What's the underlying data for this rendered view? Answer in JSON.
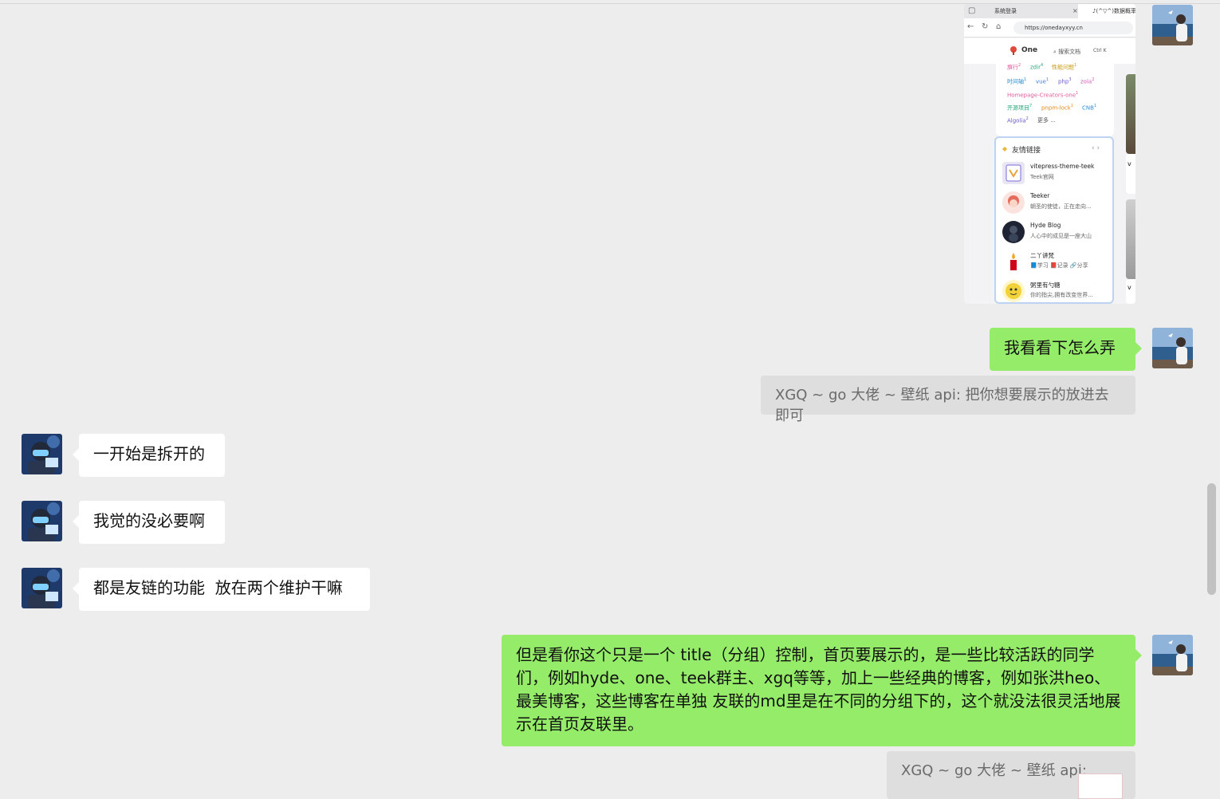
{
  "messages": {
    "m1": "我看看下怎么弄",
    "q1": "XGQ ~ go 大佬 ~ 壁纸 api: 把你想要展示的放进去即可",
    "m2": "一开始是拆开的",
    "m3": "我觉的没必要啊",
    "m4": "都是友链的功能  放在两个维护干嘛",
    "m5": "但是看你这个只是一个 title（分组）控制，首页要展示的，是一些比较活跃的同学们，例如hyde、one、teek群主、xgq等等，加上一些经典的博客，例如张洪heo、最美博客，这些博客在单独 友联的md里是在不同的分组下的，这个就没法很灵活地展示在首页友联里。",
    "q2": "XGQ ~ go 大佬 ~ 壁纸 api:"
  },
  "screenshot": {
    "tab1": "系统登录",
    "tab1_close": "×",
    "tab2": "♪(^▽^)数据概率",
    "url": "https://onedayxyy.cn",
    "logo": "One",
    "search": "搜索文档",
    "search_key": "Ctrl K",
    "tags": [
      {
        "label": "旗行",
        "count": "2",
        "color": "#e0559b"
      },
      {
        "label": "zdir",
        "count": "4",
        "color": "#23a67a"
      },
      {
        "label": "性能问题",
        "count": "1",
        "color": "#c99b12"
      },
      {
        "label": "时间轴",
        "count": "1",
        "color": "#2b8fd6"
      },
      {
        "label": "vue",
        "count": "1",
        "color": "#3b7ee0"
      },
      {
        "label": "php",
        "count": "3",
        "color": "#6a5acd"
      },
      {
        "label": "zola",
        "count": "2",
        "color": "#d35bb5"
      },
      {
        "label": "Homepage-Creators-one",
        "count": "1",
        "color": "#e05b9b"
      },
      {
        "label": "开源项目",
        "count": "7",
        "color": "#23a67a"
      },
      {
        "label": "pnpm-lock",
        "count": "1",
        "color": "#e08b1a"
      },
      {
        "label": "CNB",
        "count": "1",
        "color": "#2b8fd6"
      },
      {
        "label": "Algolia",
        "count": "2",
        "color": "#6a5acd"
      },
      {
        "label": "更多 ...",
        "count": "",
        "color": "#555555"
      }
    ],
    "friends_title": "友情链接",
    "friends_arrows": "‹ ›",
    "friends": [
      {
        "name": "vitepress-theme-teek",
        "desc": "Teek官网"
      },
      {
        "name": "Teeker",
        "desc": "朝圣的使徒，正在走向..."
      },
      {
        "name": "Hyde Blog",
        "desc": "人心中的成见是一座大山"
      },
      {
        "name": "二丫讲梵",
        "desc": "📘学习 📕记录 🔗分享"
      },
      {
        "name": "粥里有勺糖",
        "desc": "你的指尖,拥有改变世界..."
      }
    ],
    "side_letter_1": "v",
    "side_letter_2": "v"
  }
}
